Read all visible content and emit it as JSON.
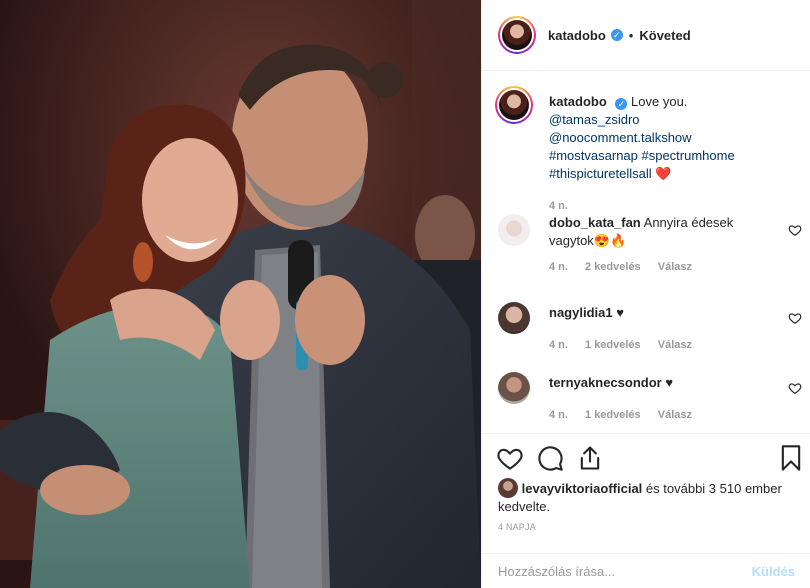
{
  "post": {
    "author": "katadobo",
    "follow_status": "Követed",
    "separator": "•"
  },
  "caption": {
    "username": "katadobo",
    "text": "Love you.",
    "mention1": "@tamas_zsidro",
    "mention2": "@noocomment.talkshow",
    "hashtags": "#mostvasarnap #spectrumhome",
    "hashtag_last": "#thispicturetellsall",
    "emoji": "❤️",
    "time": "4 n."
  },
  "comments": [
    {
      "username": "dobo_kata_fan",
      "text": "Annyira édesek vagytok",
      "emoji": "😍🔥",
      "time": "4 n.",
      "likes": "2 kedvelés",
      "reply": "Válasz"
    },
    {
      "username": "nagylidia1",
      "text": "♥",
      "emoji": "",
      "time": "4 n.",
      "likes": "1 kedvelés",
      "reply": "Válasz"
    },
    {
      "username": "ternyaknecsondor",
      "text": "♥",
      "emoji": "",
      "time": "4 n.",
      "likes": "1 kedvelés",
      "reply": "Válasz"
    }
  ],
  "likes": {
    "username": "levayviktoriaofficial",
    "text": "és további 3 510 ember kedvelte."
  },
  "date": "4 NAPJA",
  "comment_input": {
    "placeholder": "Hozzászólás írása..."
  },
  "post_button": "Küldés",
  "icons": [
    "heart-icon",
    "comment-icon",
    "share-icon",
    "bookmark-icon",
    "verified-icon",
    "small-heart-icon"
  ],
  "colors": {
    "link": "#003569",
    "verified": "#3897f0",
    "muted": "#999999",
    "post_disabled": "#b2dffc"
  }
}
